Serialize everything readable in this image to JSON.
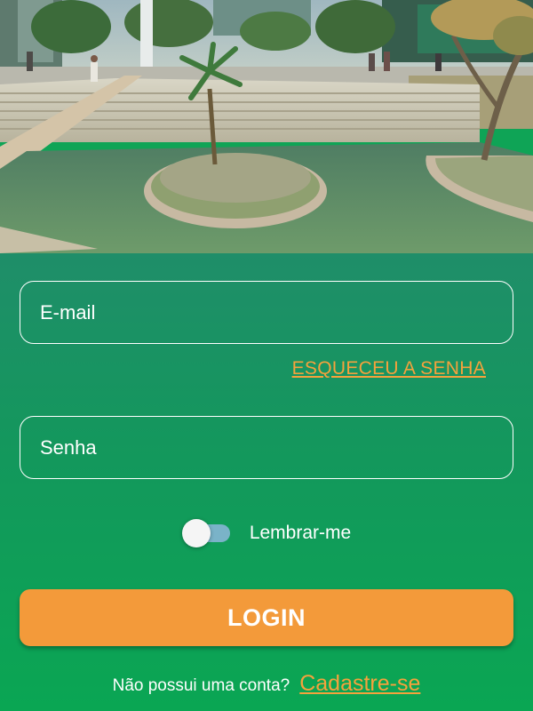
{
  "hero": {
    "image": "landscaped-plaza-with-pond"
  },
  "form": {
    "email_placeholder": "E-mail",
    "forgot_password": "ESQUECEU A SENHA",
    "password_placeholder": "Senha",
    "remember_label": "Lembrar-me",
    "remember_checked": false,
    "login_label": "LOGIN",
    "no_account_text": "Não possui uma conta?",
    "signup_link": "Cadastre-se"
  },
  "colors": {
    "panel_top": "#1f8e69",
    "panel_bottom": "#0aa653",
    "accent_orange": "#f39a3a",
    "link_orange": "#f5a23c",
    "toggle_track": "#7ab3c8",
    "field_border": "#ffffff"
  }
}
